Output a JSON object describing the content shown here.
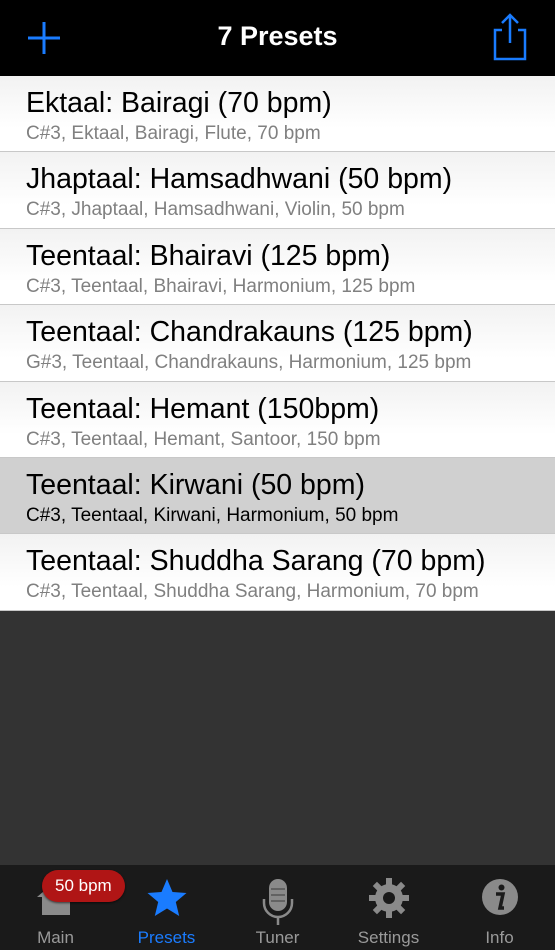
{
  "header": {
    "title": "7 Presets",
    "add_icon": "plus-icon",
    "share_icon": "share-icon"
  },
  "presets": [
    {
      "title": "Ektaal: Bairagi (70 bpm)",
      "subtitle": "C#3, Ektaal, Bairagi, Flute, 70 bpm",
      "selected": false
    },
    {
      "title": "Jhaptaal: Hamsadhwani (50 bpm)",
      "subtitle": "C#3, Jhaptaal, Hamsadhwani, Violin, 50 bpm",
      "selected": false
    },
    {
      "title": "Teentaal: Bhairavi (125 bpm)",
      "subtitle": "C#3, Teentaal, Bhairavi, Harmonium, 125 bpm",
      "selected": false
    },
    {
      "title": "Teentaal: Chandrakauns (125 bpm)",
      "subtitle": "G#3, Teentaal, Chandrakauns, Harmonium, 125 bpm",
      "selected": false
    },
    {
      "title": "Teentaal: Hemant (150bpm)",
      "subtitle": "C#3, Teentaal, Hemant, Santoor, 150 bpm",
      "selected": false
    },
    {
      "title": "Teentaal: Kirwani (50 bpm)",
      "subtitle": "C#3, Teentaal, Kirwani, Harmonium, 50 bpm",
      "selected": true
    },
    {
      "title": "Teentaal: Shuddha Sarang (70 bpm)",
      "subtitle": "C#3, Teentaal, Shuddha Sarang, Harmonium, 70 bpm",
      "selected": false
    }
  ],
  "tabbar": {
    "badge": "50 bpm",
    "tabs": [
      {
        "label": "Main",
        "icon": "home-icon",
        "active": false
      },
      {
        "label": "Presets",
        "icon": "star-icon",
        "active": true
      },
      {
        "label": "Tuner",
        "icon": "microphone-icon",
        "active": false
      },
      {
        "label": "Settings",
        "icon": "gear-icon",
        "active": false
      },
      {
        "label": "Info",
        "icon": "info-icon",
        "active": false
      }
    ]
  },
  "colors": {
    "accent": "#1a7cff",
    "badge": "#b01515",
    "selected_row": "#d0d0d0"
  }
}
